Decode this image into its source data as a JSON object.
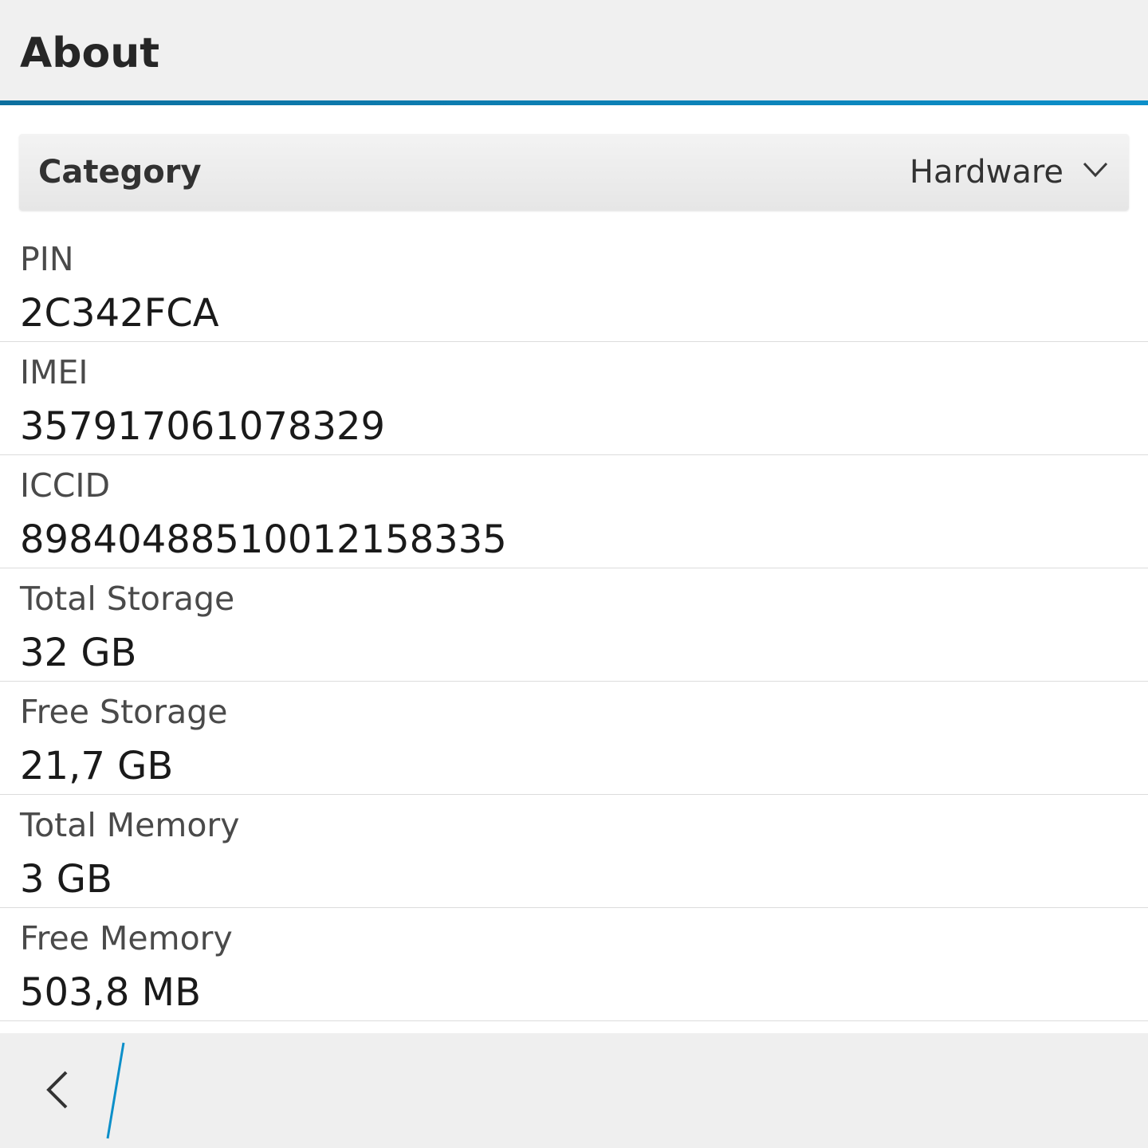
{
  "header": {
    "title": "About",
    "accent_color": "#0c8fc9"
  },
  "category_dropdown": {
    "label": "Category",
    "selected": "Hardware",
    "icon": "chevron-down-icon"
  },
  "items": [
    {
      "label": "PIN",
      "value": "2C342FCA"
    },
    {
      "label": "IMEI",
      "value": "357917061078329"
    },
    {
      "label": "ICCID",
      "value": "89840488510012158335"
    },
    {
      "label": "Total Storage",
      "value": "32 GB"
    },
    {
      "label": "Free Storage",
      "value": "21,7 GB"
    },
    {
      "label": "Total Memory",
      "value": "3 GB"
    },
    {
      "label": "Free Memory",
      "value": "503,8 MB"
    }
  ],
  "action_bar": {
    "back_icon": "chevron-left-icon"
  }
}
